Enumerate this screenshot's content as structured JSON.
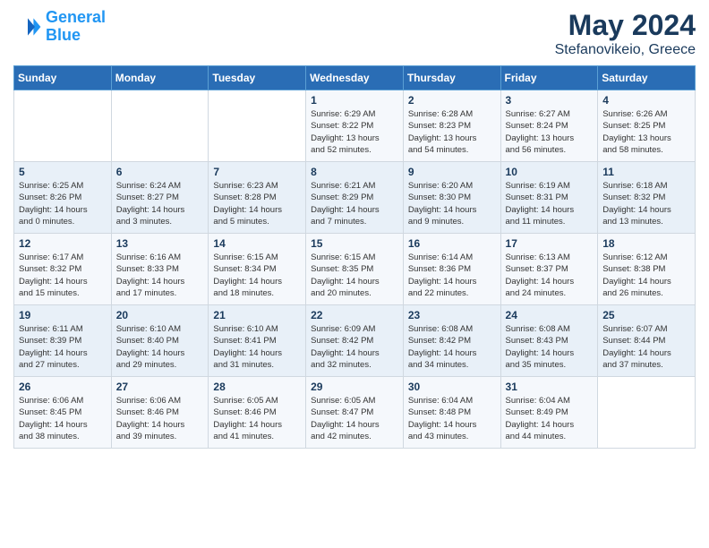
{
  "header": {
    "logo_line1": "General",
    "logo_line2": "Blue",
    "title": "May 2024",
    "subtitle": "Stefanovikeio, Greece"
  },
  "calendar": {
    "days_of_week": [
      "Sunday",
      "Monday",
      "Tuesday",
      "Wednesday",
      "Thursday",
      "Friday",
      "Saturday"
    ],
    "weeks": [
      [
        {
          "day": "",
          "info": ""
        },
        {
          "day": "",
          "info": ""
        },
        {
          "day": "",
          "info": ""
        },
        {
          "day": "1",
          "info": "Sunrise: 6:29 AM\nSunset: 8:22 PM\nDaylight: 13 hours\nand 52 minutes."
        },
        {
          "day": "2",
          "info": "Sunrise: 6:28 AM\nSunset: 8:23 PM\nDaylight: 13 hours\nand 54 minutes."
        },
        {
          "day": "3",
          "info": "Sunrise: 6:27 AM\nSunset: 8:24 PM\nDaylight: 13 hours\nand 56 minutes."
        },
        {
          "day": "4",
          "info": "Sunrise: 6:26 AM\nSunset: 8:25 PM\nDaylight: 13 hours\nand 58 minutes."
        }
      ],
      [
        {
          "day": "5",
          "info": "Sunrise: 6:25 AM\nSunset: 8:26 PM\nDaylight: 14 hours\nand 0 minutes."
        },
        {
          "day": "6",
          "info": "Sunrise: 6:24 AM\nSunset: 8:27 PM\nDaylight: 14 hours\nand 3 minutes."
        },
        {
          "day": "7",
          "info": "Sunrise: 6:23 AM\nSunset: 8:28 PM\nDaylight: 14 hours\nand 5 minutes."
        },
        {
          "day": "8",
          "info": "Sunrise: 6:21 AM\nSunset: 8:29 PM\nDaylight: 14 hours\nand 7 minutes."
        },
        {
          "day": "9",
          "info": "Sunrise: 6:20 AM\nSunset: 8:30 PM\nDaylight: 14 hours\nand 9 minutes."
        },
        {
          "day": "10",
          "info": "Sunrise: 6:19 AM\nSunset: 8:31 PM\nDaylight: 14 hours\nand 11 minutes."
        },
        {
          "day": "11",
          "info": "Sunrise: 6:18 AM\nSunset: 8:32 PM\nDaylight: 14 hours\nand 13 minutes."
        }
      ],
      [
        {
          "day": "12",
          "info": "Sunrise: 6:17 AM\nSunset: 8:32 PM\nDaylight: 14 hours\nand 15 minutes."
        },
        {
          "day": "13",
          "info": "Sunrise: 6:16 AM\nSunset: 8:33 PM\nDaylight: 14 hours\nand 17 minutes."
        },
        {
          "day": "14",
          "info": "Sunrise: 6:15 AM\nSunset: 8:34 PM\nDaylight: 14 hours\nand 18 minutes."
        },
        {
          "day": "15",
          "info": "Sunrise: 6:15 AM\nSunset: 8:35 PM\nDaylight: 14 hours\nand 20 minutes."
        },
        {
          "day": "16",
          "info": "Sunrise: 6:14 AM\nSunset: 8:36 PM\nDaylight: 14 hours\nand 22 minutes."
        },
        {
          "day": "17",
          "info": "Sunrise: 6:13 AM\nSunset: 8:37 PM\nDaylight: 14 hours\nand 24 minutes."
        },
        {
          "day": "18",
          "info": "Sunrise: 6:12 AM\nSunset: 8:38 PM\nDaylight: 14 hours\nand 26 minutes."
        }
      ],
      [
        {
          "day": "19",
          "info": "Sunrise: 6:11 AM\nSunset: 8:39 PM\nDaylight: 14 hours\nand 27 minutes."
        },
        {
          "day": "20",
          "info": "Sunrise: 6:10 AM\nSunset: 8:40 PM\nDaylight: 14 hours\nand 29 minutes."
        },
        {
          "day": "21",
          "info": "Sunrise: 6:10 AM\nSunset: 8:41 PM\nDaylight: 14 hours\nand 31 minutes."
        },
        {
          "day": "22",
          "info": "Sunrise: 6:09 AM\nSunset: 8:42 PM\nDaylight: 14 hours\nand 32 minutes."
        },
        {
          "day": "23",
          "info": "Sunrise: 6:08 AM\nSunset: 8:42 PM\nDaylight: 14 hours\nand 34 minutes."
        },
        {
          "day": "24",
          "info": "Sunrise: 6:08 AM\nSunset: 8:43 PM\nDaylight: 14 hours\nand 35 minutes."
        },
        {
          "day": "25",
          "info": "Sunrise: 6:07 AM\nSunset: 8:44 PM\nDaylight: 14 hours\nand 37 minutes."
        }
      ],
      [
        {
          "day": "26",
          "info": "Sunrise: 6:06 AM\nSunset: 8:45 PM\nDaylight: 14 hours\nand 38 minutes."
        },
        {
          "day": "27",
          "info": "Sunrise: 6:06 AM\nSunset: 8:46 PM\nDaylight: 14 hours\nand 39 minutes."
        },
        {
          "day": "28",
          "info": "Sunrise: 6:05 AM\nSunset: 8:46 PM\nDaylight: 14 hours\nand 41 minutes."
        },
        {
          "day": "29",
          "info": "Sunrise: 6:05 AM\nSunset: 8:47 PM\nDaylight: 14 hours\nand 42 minutes."
        },
        {
          "day": "30",
          "info": "Sunrise: 6:04 AM\nSunset: 8:48 PM\nDaylight: 14 hours\nand 43 minutes."
        },
        {
          "day": "31",
          "info": "Sunrise: 6:04 AM\nSunset: 8:49 PM\nDaylight: 14 hours\nand 44 minutes."
        },
        {
          "day": "",
          "info": ""
        }
      ]
    ]
  }
}
